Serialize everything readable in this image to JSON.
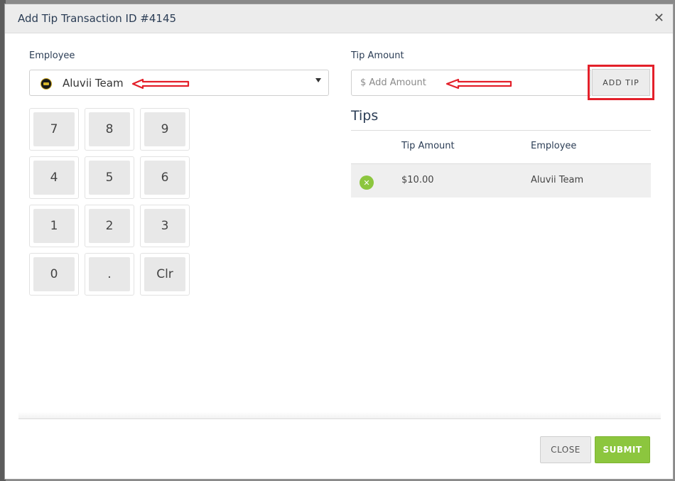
{
  "modal": {
    "title": "Add Tip Transaction ID #4145",
    "close_icon": "close-icon"
  },
  "employee": {
    "label": "Employee",
    "selected": "Aluvii Team",
    "logo_icon": "team-logo-icon"
  },
  "keypad": {
    "keys": [
      "7",
      "8",
      "9",
      "4",
      "5",
      "6",
      "1",
      "2",
      "3",
      "0",
      ".",
      "Clr"
    ]
  },
  "tip_amount": {
    "label": "Tip Amount",
    "placeholder": "$ Add Amount",
    "value": "",
    "add_button_label": "ADD TIP"
  },
  "tips": {
    "heading": "Tips",
    "columns": [
      "Tip Amount",
      "Employee"
    ],
    "rows": [
      {
        "amount": "$10.00",
        "employee": "Aluvii Team"
      }
    ],
    "remove_icon": "remove-icon"
  },
  "footer": {
    "close_label": "CLOSE",
    "submit_label": "SUBMIT"
  },
  "colors": {
    "accent_green": "#8cc63e",
    "title_navy": "#2b3d55",
    "annotation_red": "#e3202a"
  }
}
